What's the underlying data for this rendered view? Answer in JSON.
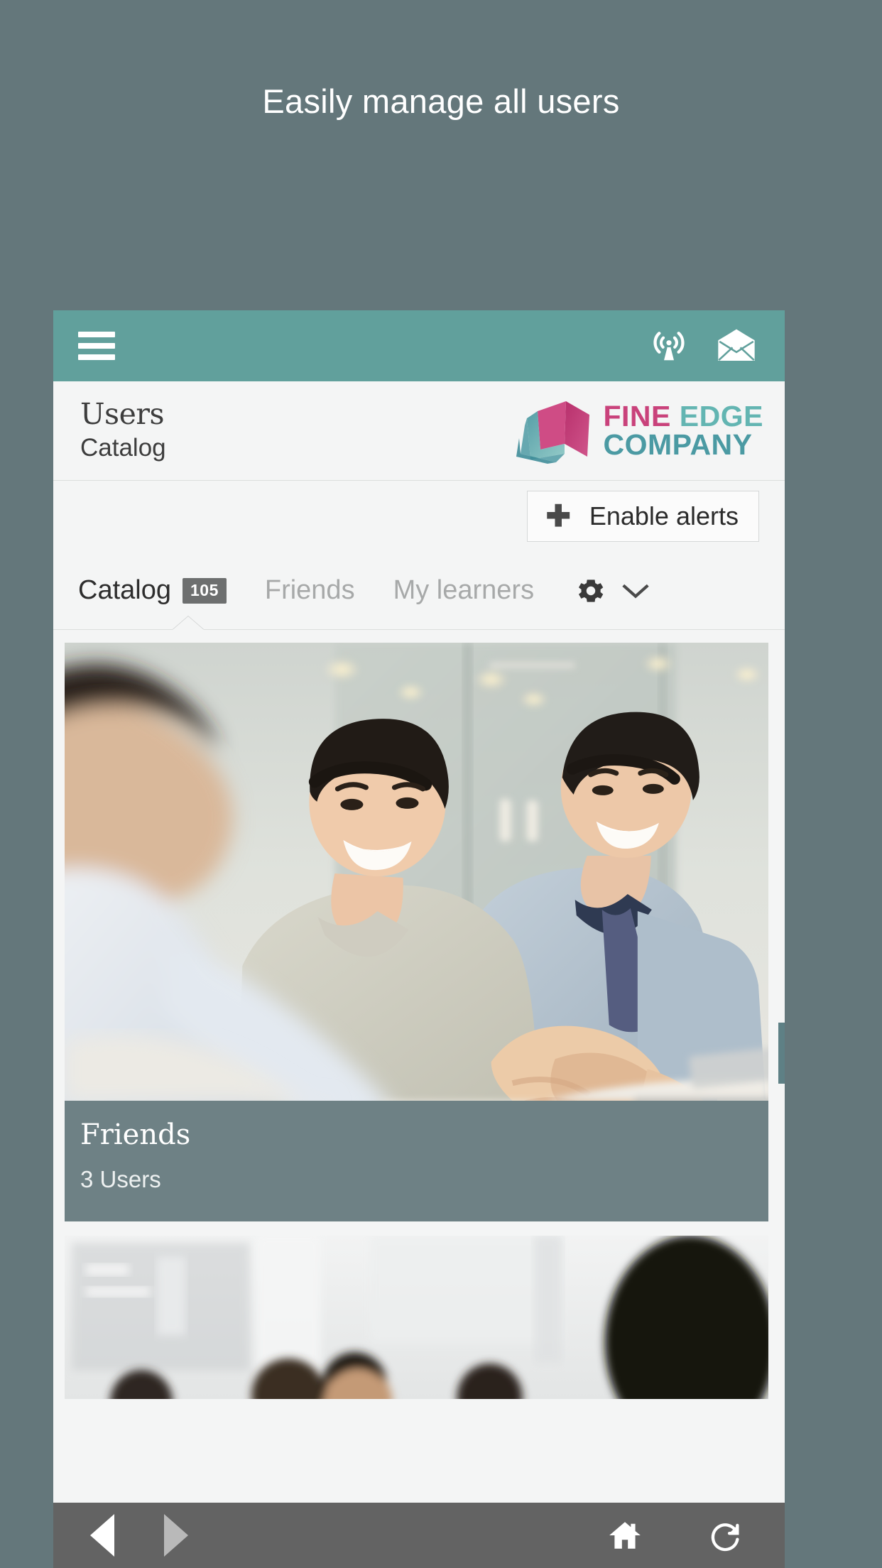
{
  "promo": {
    "headline": "Easily manage all users"
  },
  "page_bg": "#64777b",
  "appbar": {
    "bg": "#61a09c",
    "menu_icon": "hamburger-menu-icon",
    "broadcast_icon": "broadcast-antenna-icon",
    "mail_icon": "envelope-mail-icon"
  },
  "header": {
    "title": "Users",
    "subtitle": "Catalog",
    "logo": {
      "word1": "FINE",
      "word2": "EDGE",
      "word3": "COMPANY",
      "word1_color": "#c9427b",
      "word2_color": "#63b5b2",
      "word3_color": "#4b9aa3",
      "mark_icon": "open-book-pages-logo-icon"
    }
  },
  "toolbar": {
    "enable_alerts_label": "Enable alerts",
    "plus_icon": "plus-icon"
  },
  "tabs": {
    "items": [
      {
        "label": "Catalog",
        "badge": "105",
        "active": true
      },
      {
        "label": "Friends",
        "badge": "",
        "active": false
      },
      {
        "label": "My learners",
        "badge": "",
        "active": false
      }
    ],
    "settings_icon": "gear-icon",
    "chevron_icon": "chevron-down-icon"
  },
  "cards": [
    {
      "title": "Friends",
      "subtitle": "3 Users",
      "image_alt": "two-colleagues-shaking-hands-in-office"
    },
    {
      "title": "",
      "subtitle": "",
      "image_alt": "group-of-people-in-meeting-room"
    }
  ],
  "bottomnav": {
    "back_icon": "back-arrow-icon",
    "forward_icon": "forward-arrow-icon",
    "home_icon": "home-icon",
    "reload_icon": "reload-refresh-icon"
  }
}
